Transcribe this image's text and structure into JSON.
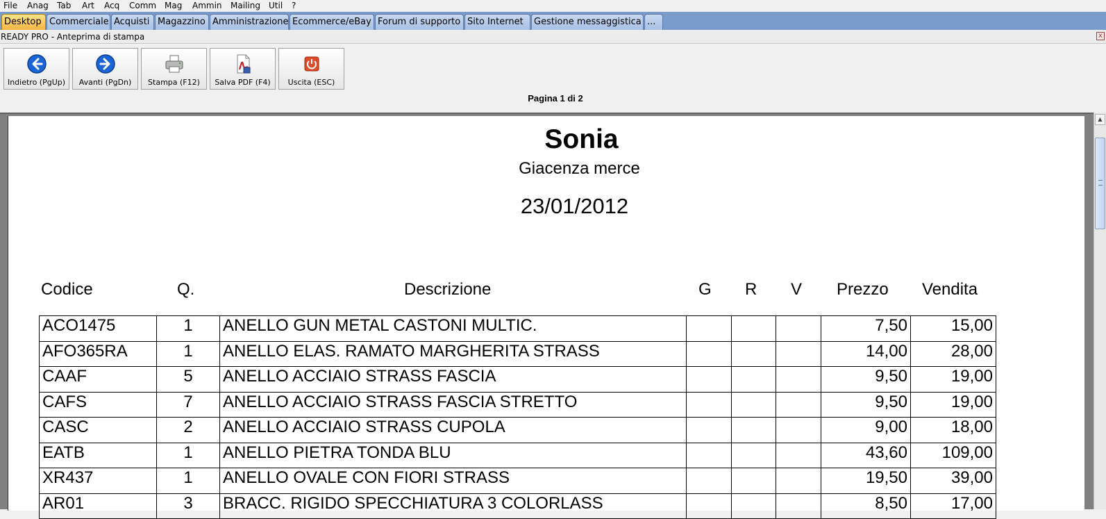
{
  "menu": [
    "File",
    "Anag",
    "Tab",
    "Art",
    "Acq",
    "Comm",
    "Mag",
    "Ammin",
    "Mailing",
    "Util",
    "?"
  ],
  "tabs": [
    {
      "label": "Desktop",
      "active": true
    },
    {
      "label": "Commerciale",
      "active": false
    },
    {
      "label": "Acquisti",
      "active": false
    },
    {
      "label": "Magazzino",
      "active": false
    },
    {
      "label": "Amministrazione",
      "active": false
    },
    {
      "label": "Ecommerce/eBay",
      "active": false
    },
    {
      "label": "Forum di supporto",
      "active": false
    },
    {
      "label": "Sito Internet",
      "active": false
    },
    {
      "label": "Gestione messaggistica",
      "active": false
    },
    {
      "label": "...",
      "active": false
    }
  ],
  "window": {
    "title": "READY PRO - Anteprima di stampa",
    "close": "x"
  },
  "toolbar": {
    "back": "Indietro (PgUp)",
    "forward": "Avanti (PgDn)",
    "print": "Stampa (F12)",
    "save_pdf": "Salva PDF (F4)",
    "exit": "Uscita (ESC)"
  },
  "page_indicator": "Pagina 1 di 2",
  "document": {
    "title": "Sonia",
    "subtitle": "Giacenza merce",
    "date": "23/01/2012",
    "columns": {
      "code": "Codice",
      "qty": "Q.",
      "desc": "Descrizione",
      "g": "G",
      "r": "R",
      "v": "V",
      "price": "Prezzo",
      "sale": "Vendita"
    },
    "rows": [
      {
        "code": "ACO1475",
        "qty": "1",
        "desc": "ANELLO GUN METAL CASTONI MULTIC.",
        "g": "",
        "r": "",
        "v": "",
        "price": "7,50",
        "sale": "15,00"
      },
      {
        "code": "AFO365RA",
        "qty": "1",
        "desc": "ANELLO ELAS. RAMATO MARGHERITA STRASS",
        "g": "",
        "r": "",
        "v": "",
        "price": "14,00",
        "sale": "28,00"
      },
      {
        "code": "CAAF",
        "qty": "5",
        "desc": "ANELLO ACCIAIO STRASS FASCIA",
        "g": "",
        "r": "",
        "v": "",
        "price": "9,50",
        "sale": "19,00"
      },
      {
        "code": "CAFS",
        "qty": "7",
        "desc": "ANELLO ACCIAIO STRASS FASCIA STRETTO",
        "g": "",
        "r": "",
        "v": "",
        "price": "9,50",
        "sale": "19,00"
      },
      {
        "code": "CASC",
        "qty": "2",
        "desc": "ANELLO ACCIAIO STRASS CUPOLA",
        "g": "",
        "r": "",
        "v": "",
        "price": "9,00",
        "sale": "18,00"
      },
      {
        "code": "EATB",
        "qty": "1",
        "desc": "ANELLO PIETRA TONDA BLU",
        "g": "",
        "r": "",
        "v": "",
        "price": "43,60",
        "sale": "109,00"
      },
      {
        "code": "XR437",
        "qty": "1",
        "desc": "ANELLO OVALE CON FIORI STRASS",
        "g": "",
        "r": "",
        "v": "",
        "price": "19,50",
        "sale": "39,00"
      },
      {
        "code": "AR01",
        "qty": "3",
        "desc": "BRACC. RIGIDO SPECCHIATURA 3 COLORLASS",
        "g": "",
        "r": "",
        "v": "",
        "price": "8,50",
        "sale": "17,00"
      }
    ]
  }
}
